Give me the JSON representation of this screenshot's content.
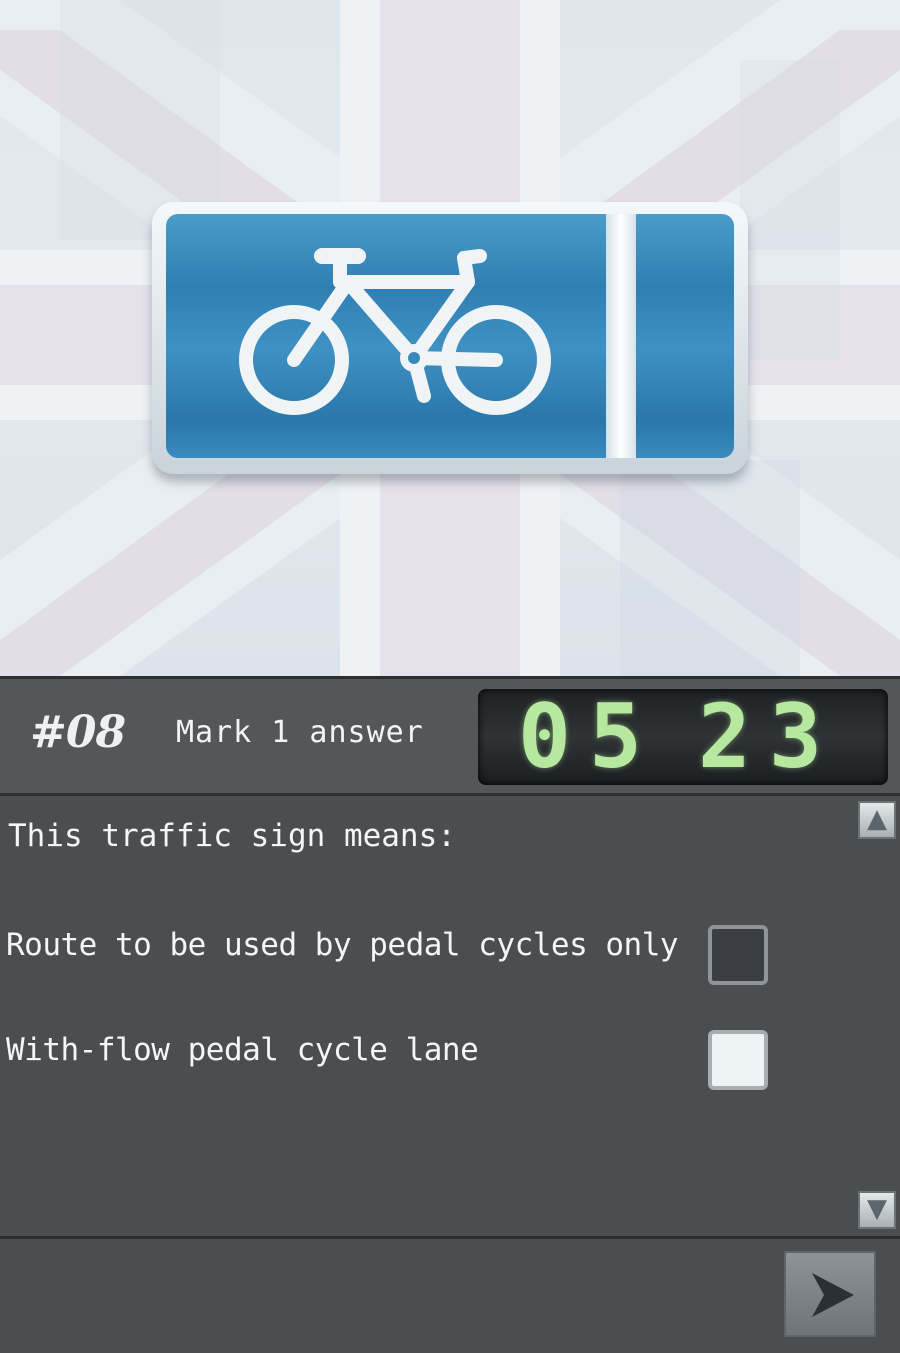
{
  "question": {
    "number": "#08",
    "instruction": "Mark 1 answer",
    "text": "This traffic sign means:"
  },
  "timer": {
    "minutes": "05",
    "seconds": "23"
  },
  "answers": [
    {
      "label": "Route to be used by pedal cycles only",
      "checked": false
    },
    {
      "label": "With-flow pedal cycle lane",
      "checked": false
    }
  ],
  "icons": {
    "sign": "bicycle-icon",
    "scroll_up": "chevron-up-icon",
    "scroll_down": "chevron-down-icon",
    "next": "arrow-right-icon"
  },
  "colors": {
    "sign_blue": "#3a89bd",
    "timer_digits": "#b7e8a0",
    "panel": "#4b4e51"
  }
}
